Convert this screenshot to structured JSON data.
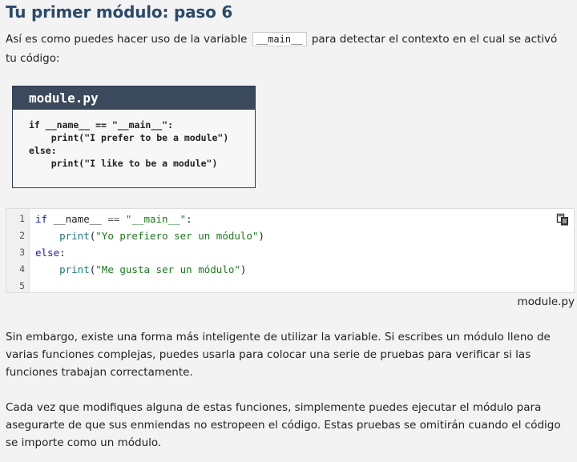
{
  "page": {
    "title": "Tu primer módulo: paso 6",
    "intro_before": "Así es como puedes hacer uso de la variable",
    "intro_code": "__main__",
    "intro_after": "para detectar el contexto en el cual se activó tu código:"
  },
  "figure": {
    "filename": "module.py",
    "code_lines": [
      "if __name__ == \"__main__\":",
      "    print(\"I prefer to be a module\")",
      "else:",
      "    print(\"I like to be a module\")"
    ]
  },
  "editor": {
    "line_numbers": [
      "1",
      "2",
      "3",
      "4",
      "5"
    ],
    "lines": [
      [
        {
          "t": "if ",
          "c": "kw"
        },
        {
          "t": "__name__ ",
          "c": ""
        },
        {
          "t": "== ",
          "c": "op"
        },
        {
          "t": "\"__main__\"",
          "c": "str"
        },
        {
          "t": ":",
          "c": ""
        }
      ],
      [
        {
          "t": "    ",
          "c": ""
        },
        {
          "t": "print",
          "c": "fn"
        },
        {
          "t": "(",
          "c": ""
        },
        {
          "t": "\"Yo prefiero ser un módulo\"",
          "c": "str"
        },
        {
          "t": ")",
          "c": ""
        }
      ],
      [
        {
          "t": "else",
          "c": "kw"
        },
        {
          "t": ":",
          "c": ""
        }
      ],
      [
        {
          "t": "    ",
          "c": ""
        },
        {
          "t": "print",
          "c": "fn"
        },
        {
          "t": "(",
          "c": ""
        },
        {
          "t": "\"Me gusta ser un módulo\"",
          "c": "str"
        },
        {
          "t": ")",
          "c": ""
        }
      ],
      []
    ],
    "copy_icon": "copy-icon",
    "caption": "module.py"
  },
  "body": {
    "paragraph_1": "Sin embargo, existe una forma más inteligente de utilizar la variable. Si escribes un módulo lleno de varias funciones complejas, puedes usarla para colocar una serie de pruebas para verificar si las funciones trabajan correctamente.",
    "paragraph_2": "Cada vez que modifiques alguna de estas funciones, simplemente puedes ejecutar el módulo para asegurarte de que sus enmiendas no estropeen el código. Estas pruebas se omitirán cuando el código se importe como un módulo."
  },
  "colors": {
    "title": "#2b4a6b",
    "figure_header": "#3a4a5c",
    "keyword": "#1a1aa6",
    "string": "#1a7a1a",
    "function": "#1a7a7a"
  }
}
